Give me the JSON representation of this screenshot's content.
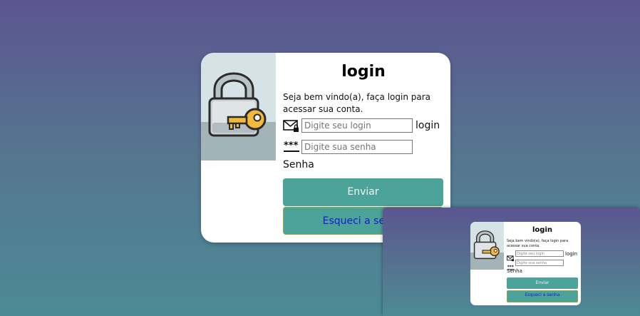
{
  "login_card": {
    "title": "login",
    "welcome_text": "Seja bem vindo(a), faça login para acessar sua conta.",
    "login_field": {
      "placeholder": "Digite seu login",
      "value": "",
      "label": "login"
    },
    "password_field": {
      "placeholder": "Digite sua senha",
      "value": "",
      "label": "Senha"
    },
    "submit_label": "Enviar",
    "forgot_label": "Esqueci a senha"
  },
  "preview": {
    "title": "login",
    "welcome_text": "Seja bem vindo(a), faça login para acessar sua conta.",
    "login_placeholder": "Digite seu login",
    "login_label": "login",
    "password_placeholder": "Digite sua senha",
    "password_label": "Senha",
    "submit_label": "Enviar",
    "forgot_label": "Esqueci a senha"
  },
  "icons": {
    "illustration": "padlock-with-key-icon",
    "login_field": "envelope-lock-icon",
    "password_field": "password-dots-icon"
  },
  "colors": {
    "background_top": "#5b5590",
    "background_bottom": "#4c8a97",
    "button": "#4ca399",
    "forgot_text": "#1a1acc",
    "forgot_border": "#9aa23a"
  }
}
